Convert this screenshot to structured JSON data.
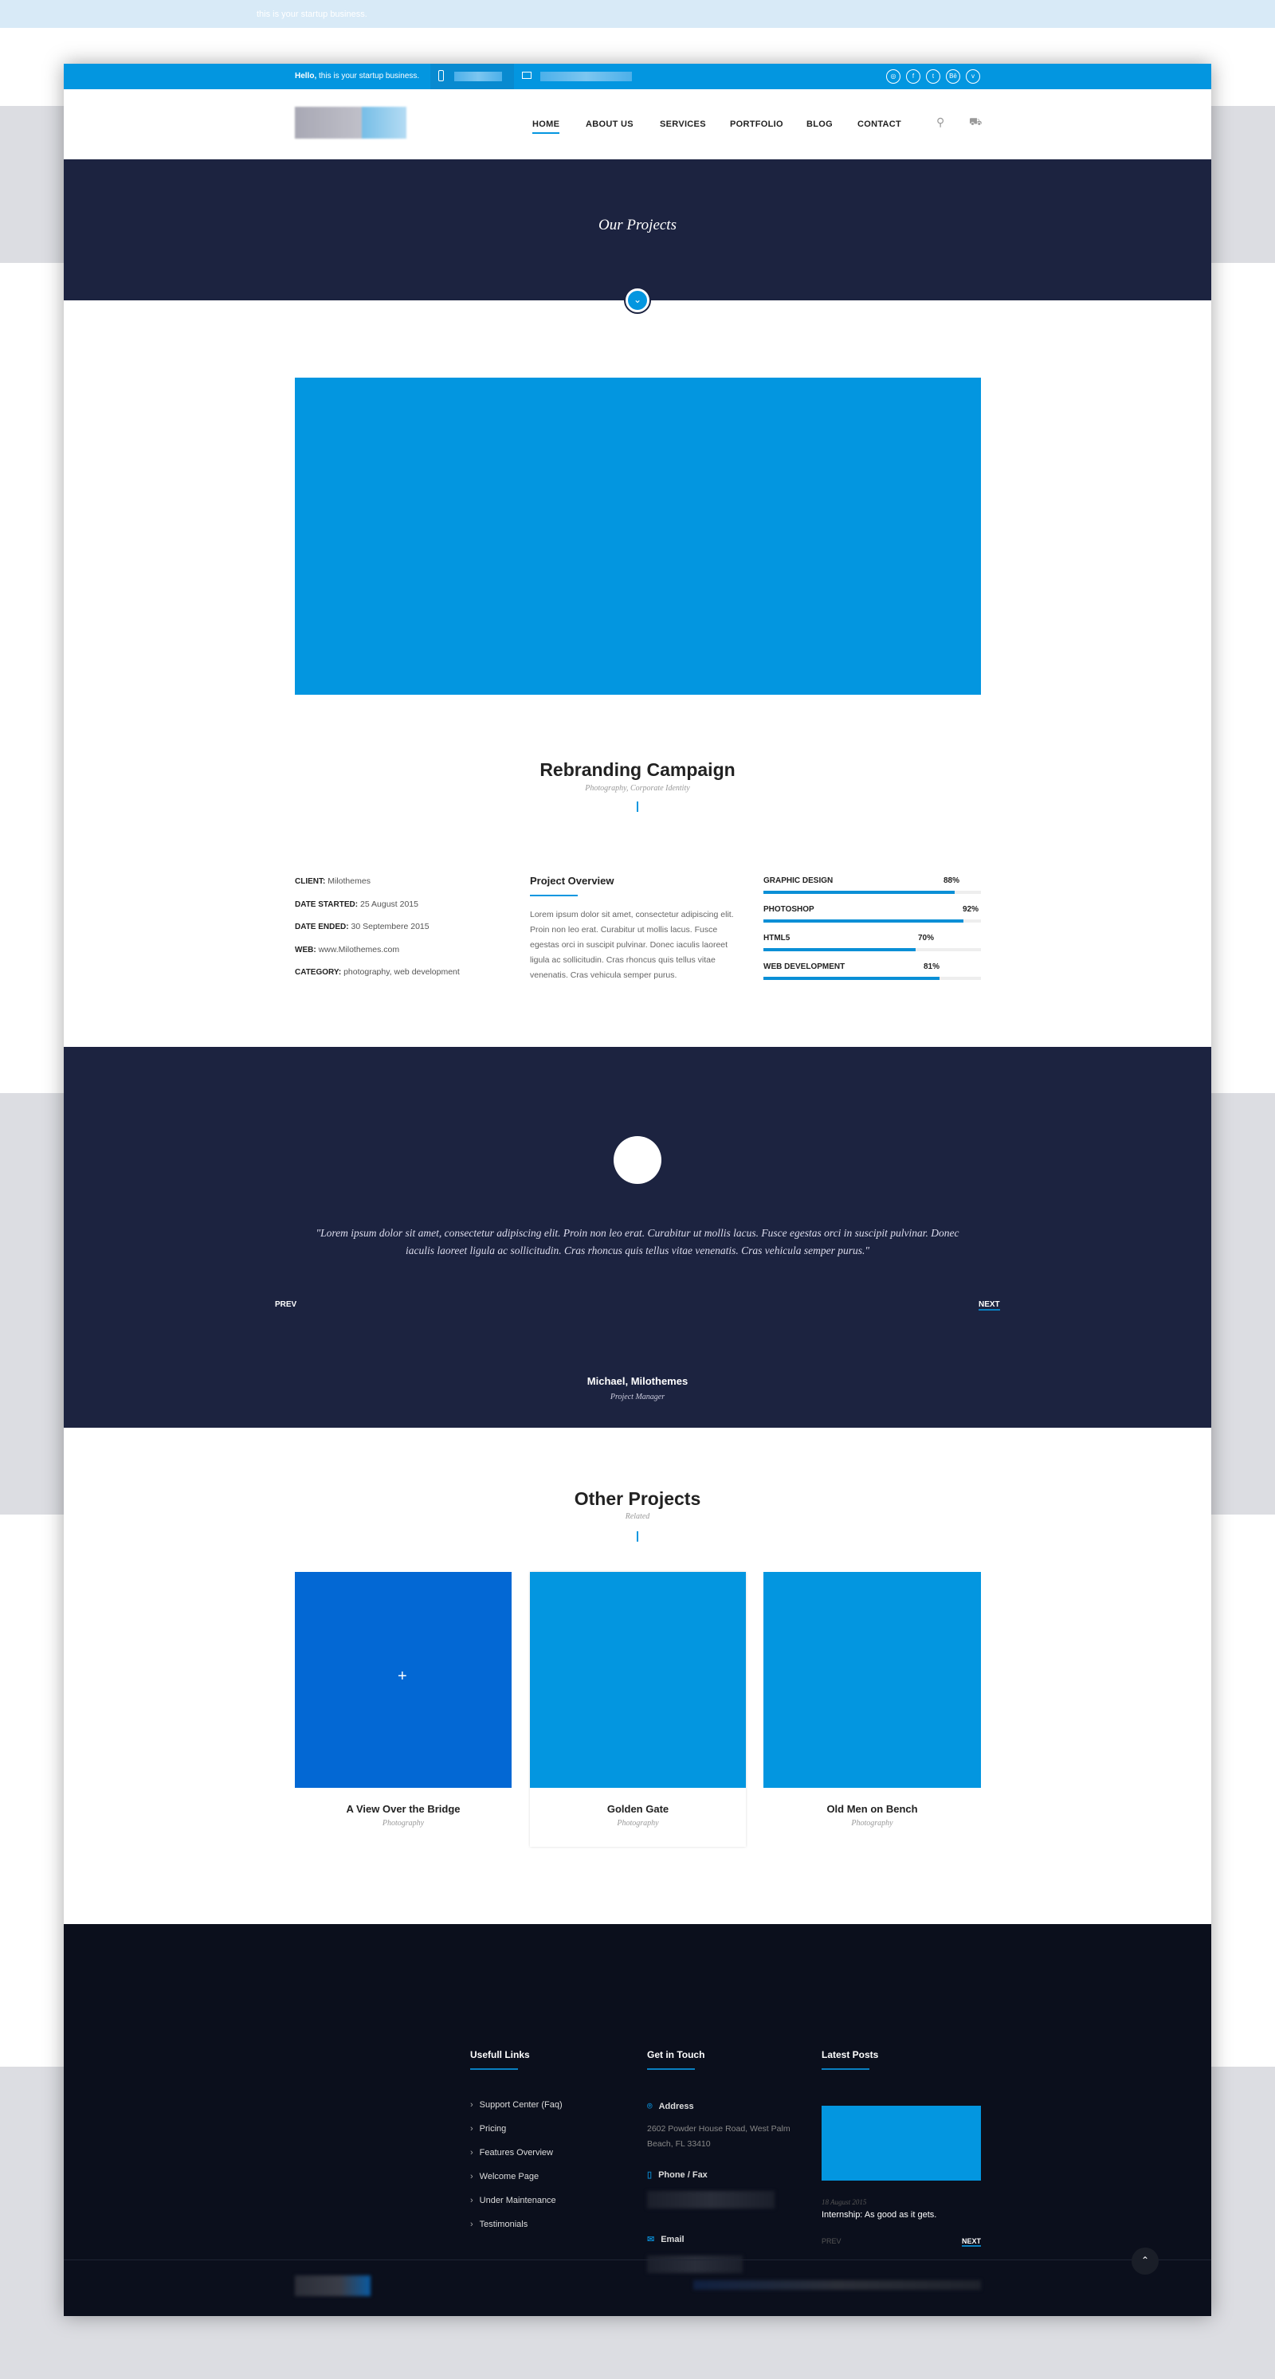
{
  "topbar": {
    "hello_bold": "Hello,",
    "hello_text": " this is your startup business.",
    "social": [
      "dribbble",
      "facebook",
      "twitter",
      "behance",
      "vimeo"
    ]
  },
  "nav": {
    "items": [
      "HOME",
      "ABOUT US",
      "SERVICES",
      "PORTFOLIO",
      "BLOG",
      "CONTACT"
    ],
    "active": "HOME"
  },
  "hero": {
    "title": "Our Projects"
  },
  "project": {
    "title": "Rebranding Campaign",
    "subtitle": "Photography, Corporate Identity",
    "details": [
      {
        "label": "CLIENT:",
        "value": "Milothemes"
      },
      {
        "label": "DATE STARTED:",
        "value": "25 August 2015"
      },
      {
        "label": "DATE ENDED:",
        "value": "30 Septembere 2015"
      },
      {
        "label": "WEB:",
        "value": "www.Milothemes.com"
      },
      {
        "label": "CATEGORY:",
        "value": "photography, web development"
      }
    ],
    "overview_title": "Project Overview",
    "overview_text": "Lorem ipsum dolor sit amet, consectetur adipiscing elit. Proin non leo erat. Curabitur ut mollis lacus. Fusce egestas orci in suscipit pulvinar. Donec iaculis laoreet ligula ac sollicitudin. Cras rhoncus quis tellus vitae venenatis. Cras vehicula semper purus.",
    "skills": [
      {
        "name": "GRAPHIC DESIGN",
        "label": "88%",
        "value": 88
      },
      {
        "name": "PHOTOSHOP",
        "label": "92%",
        "value": 92
      },
      {
        "name": "HTML5",
        "label": "70%",
        "value": 70
      },
      {
        "name": "WEB DEVELOPMENT",
        "label": "81%",
        "value": 81
      }
    ]
  },
  "testimonial": {
    "quote": "\"Lorem ipsum dolor sit amet, consectetur adipiscing elit. Proin non leo erat. Curabitur ut mollis lacus. Fusce egestas orci in suscipit pulvinar. Donec iaculis laoreet ligula ac sollicitudin. Cras rhoncus quis tellus vitae venenatis. Cras vehicula semper purus.\"",
    "name": "Michael, Milothemes",
    "role": "Project Manager",
    "prev": "PREV",
    "next": "NEXT"
  },
  "other": {
    "title": "Other Projects",
    "subtitle": "Related",
    "cards": [
      {
        "title": "A View Over the Bridge",
        "category": "Photography"
      },
      {
        "title": "Golden Gate",
        "category": "Photography"
      },
      {
        "title": "Old Men on Bench",
        "category": "Photography"
      }
    ]
  },
  "footer": {
    "links_title": "Usefull Links",
    "links": [
      "Support Center (Faq)",
      "Pricing",
      "Features Overview",
      "Welcome Page",
      "Under Maintenance",
      "Testimonials"
    ],
    "contact_title": "Get in Touch",
    "address_label": "Address",
    "address": "2602 Powder House Road, West Palm Beach, FL 33410",
    "phone_label": "Phone / Fax",
    "email_label": "Email",
    "posts_title": "Latest Posts",
    "post_date": "18 August 2015",
    "post_title": "Internship: As good as it gets.",
    "prev": "PREV",
    "next": "NEXT"
  },
  "colors": {
    "accent": "#0396e0",
    "dark": "#1c2340",
    "footer": "#0b0f1c"
  }
}
